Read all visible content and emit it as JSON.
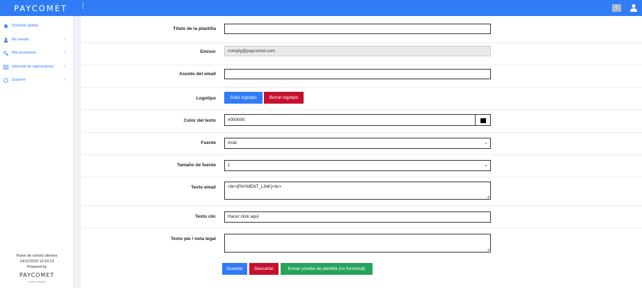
{
  "header": {
    "logo": "PAYCOMET",
    "menu_icon": "vertical-dots-icon",
    "notification_count": "0",
    "user_icon": "user-icon"
  },
  "sidebar": {
    "items": [
      {
        "label": "Posición global",
        "icon": "home-icon"
      },
      {
        "label": "Mi cuenta",
        "icon": "user-icon"
      },
      {
        "label": "Mis productos",
        "icon": "products-icon"
      },
      {
        "label": "Historial de operaciones",
        "icon": "history-icon"
      },
      {
        "label": "Soporte",
        "icon": "support-icon"
      }
    ],
    "footer": {
      "line1": "Panel de control clientes",
      "timestamp": "24/11/2020 13:43:13",
      "powered": "Powered by",
      "logo": "PAYCOMET",
      "logo_sub": "by Banco Sabadell"
    }
  },
  "form": {
    "titulo": {
      "label": "Título de la plantilla",
      "value": ""
    },
    "emisor": {
      "label": "Emisor",
      "value": "noreply@paycomet.com"
    },
    "asunto": {
      "label": "Asunto del email",
      "value": ""
    },
    "logotipo": {
      "label": "Logotipo",
      "upload": "Subir logotipo",
      "delete": "Borrar logotipo"
    },
    "color": {
      "label": "Color del texto",
      "value": "#000000",
      "swatch": "#000000"
    },
    "fuente": {
      "label": "Fuente",
      "value": "Arial"
    },
    "tamano": {
      "label": "Tamaño de fuente",
      "value": "1"
    },
    "texto_email": {
      "label": "Texto email",
      "value": "<br>{PAYMENT_LINK}<br>"
    },
    "texto_clic": {
      "label": "Texto clic",
      "value": "Hacer click aquí"
    },
    "pie": {
      "label": "Texto pie / nota legal",
      "value": ""
    }
  },
  "actions": {
    "save": "Guardar",
    "discard": "Descartar",
    "test": "Enviar prueba de plantilla (no funcional)"
  },
  "colors": {
    "primary": "#2f7cf6",
    "danger": "#c5102f",
    "success": "#27a35a"
  }
}
